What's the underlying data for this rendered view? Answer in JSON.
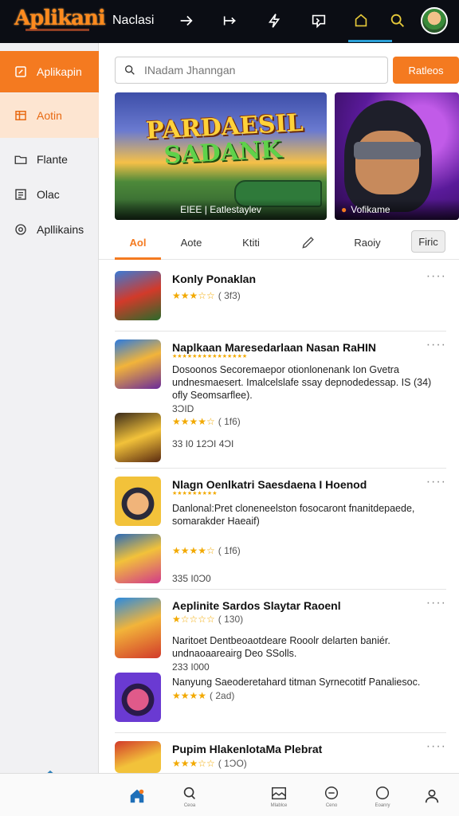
{
  "topbar": {
    "logo": "Aplikani",
    "title": "Naclasi",
    "icons": [
      "arrow-right-icon",
      "arrow-bar-right-icon",
      "lightning-icon",
      "message-icon",
      "home-outline-icon",
      "search-icon"
    ]
  },
  "sidebar": {
    "items": [
      {
        "label": "Aplikapin",
        "icon": "edit-icon"
      },
      {
        "label": "Aotin",
        "icon": "grid-list-icon"
      },
      {
        "label": "Flante",
        "icon": "folder-icon"
      },
      {
        "label": "Olac",
        "icon": "list-icon"
      },
      {
        "label": "Apllikains",
        "icon": "badge-icon"
      }
    ]
  },
  "search": {
    "placeholder": "INadam Jhanngan",
    "button": "Ratleos"
  },
  "banners": [
    {
      "title_line1": "PARDAESIL",
      "title_line2": "SADANK",
      "caption": "EIEE | Eatlestaylev"
    },
    {
      "caption": "Vofikame"
    }
  ],
  "tabs": [
    "Aol",
    "Aote",
    "Ktiti",
    "",
    "Raoiy"
  ],
  "tab_button": "Firic",
  "apps": [
    {
      "name": "Konly Ponaklan",
      "stars": "★★★☆☆",
      "count": "( 3f3)"
    },
    {
      "name": "Naplkaan Maresedarlaan Nasan RaHIN",
      "desc": "Dosoonos Secoremaepor otionlonenank Ion Gvetra undnesmaesert. Imalcelslafe ssay depnodedessap. IS (34) ofly Seomsarflee).",
      "meta": "3ƆID"
    },
    {
      "name": "",
      "stars": "★★★★☆",
      "count": "( 1f6)",
      "meta": "33 I0 12ƆI 4ƆI"
    },
    {
      "name": "Nlagn Oenlkatri Saesdaena I Hoenod",
      "desc": "Danlonal:Pret cloneneelston fosocaront fnanitdepaede, somarakder Haeaif)"
    },
    {
      "name": "",
      "stars": "★★★★☆",
      "count": "( 1f6)",
      "meta": "335 I0Ɔ0"
    },
    {
      "name": "Aeplinite Sardos Slaytar Raoenl",
      "stars": "★☆☆☆☆",
      "count": "( 130)",
      "desc": "Naritoet Dentbeoaotdeare Rooolr delarten baniér. undnaoaareairg Deo SSolls.",
      "meta": "233 I000"
    },
    {
      "name": "",
      "stars": "★★★★",
      "count": "( 2ad)",
      "desc": "Nanyung Saeoderetahard titman Syrnecotitf Panaliesoc."
    },
    {
      "name": "Pupim HlakenlotaMa Plebrat",
      "stars": "★★★☆☆",
      "count": "( 1ƆO)"
    }
  ],
  "more_label": "····",
  "bottom_nav": [
    {
      "icon": "home-icon",
      "label": ""
    },
    {
      "icon": "search-icon",
      "label": "Ceoa"
    },
    {
      "icon": "gallery-icon",
      "label": "Mlablce"
    },
    {
      "icon": "chat-icon",
      "label": "Ceno"
    },
    {
      "icon": "circle-icon",
      "label": "Eoanry"
    },
    {
      "icon": "profile-icon",
      "label": ""
    }
  ],
  "colors": {
    "accent": "#f47a20",
    "topbar": "#0b0d14",
    "star": "#f2a900",
    "active_line": "#2a9fd6"
  }
}
